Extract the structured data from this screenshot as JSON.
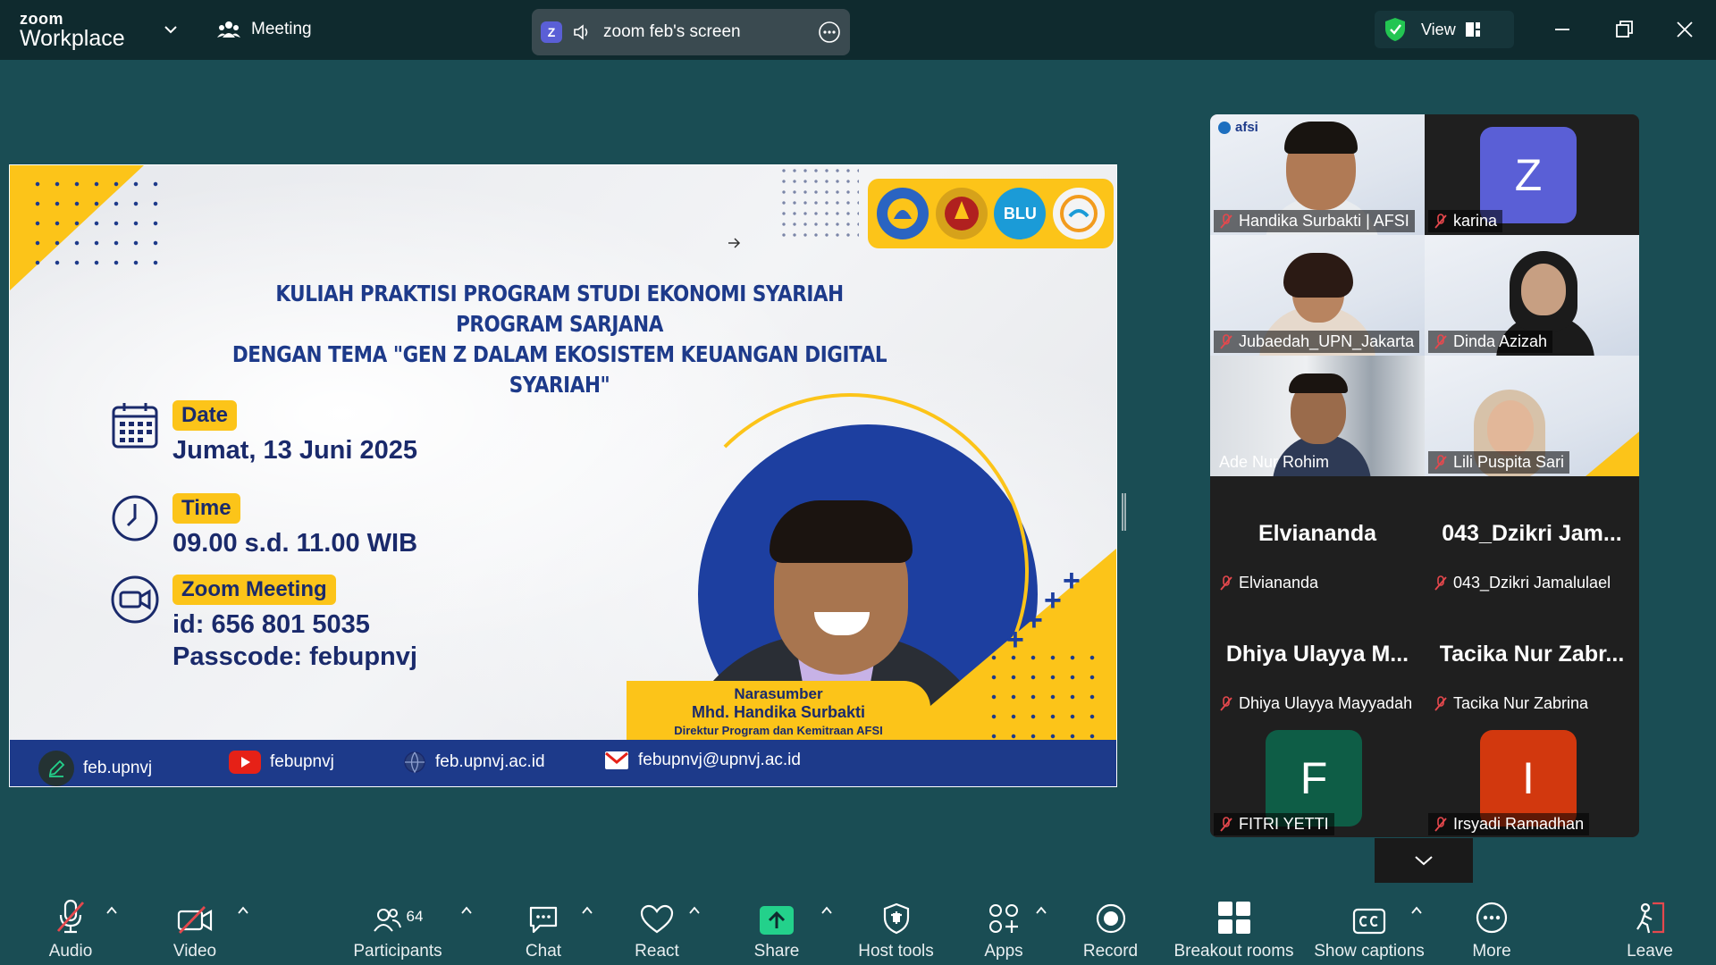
{
  "titlebar": {
    "logo_top": "zoom",
    "logo_bottom": "Workplace",
    "meeting_label": "Meeting",
    "zoom_badge": "Z",
    "share_label": "zoom feb's screen",
    "view_label": "View"
  },
  "slide": {
    "title_line1": "KULIAH PRAKTISI PROGRAM STUDI EKONOMI SYARIAH PROGRAM SARJANA",
    "title_line2": "DENGAN TEMA \"GEN Z DALAM EKOSISTEM KEUANGAN DIGITAL SYARIAH\"",
    "date_label": "Date",
    "date_value": "Jumat, 13 Juni 2025",
    "time_label": "Time",
    "time_value": "09.00 s.d. 11.00 WIB",
    "zoom_label": "Zoom Meeting",
    "zoom_id": "id: 656 801 5035",
    "zoom_pass": "Passcode: febupnvj",
    "speaker_role": "Narasumber",
    "speaker_name": "Mhd. Handika Surbakti",
    "speaker_title": "Direktur Program dan Kemitraan AFSI",
    "logo_blu": "BLU",
    "footer": {
      "instagram": "feb.upnvj",
      "youtube": "febupnvj",
      "web": "feb.upnvj.ac.id",
      "email": "febupnvj@upnvj.ac.id"
    }
  },
  "gallery": {
    "afsi_logo": "afsi",
    "tiles": [
      {
        "name": "Handika Surbakti | AFSI"
      },
      {
        "name": "karina",
        "initial": "Z",
        "color": "#5a5fd6"
      },
      {
        "name": "Jubaedah_UPN_Jakarta"
      },
      {
        "name": "Dinda Azizah"
      },
      {
        "name": "Ade Nur Rohim"
      },
      {
        "name": "Lili Puspita Sari"
      },
      {
        "name": "Elviananda",
        "display": "Elviananda"
      },
      {
        "name": "043_Dzikri Jamalulael",
        "display": "043_Dzikri  Jam..."
      },
      {
        "name": "Dhiya Ulayya Mayyadah",
        "display": "Dhiya Ulayya M..."
      },
      {
        "name": "Tacika Nur Zabrina",
        "display": "Tacika Nur Zabr..."
      },
      {
        "name": "FITRI YETTI",
        "initial": "F",
        "color": "#0e5d46"
      },
      {
        "name": "Irsyadi Ramadhan",
        "initial": "I",
        "color": "#d2380e"
      }
    ]
  },
  "toolbar": {
    "audio": "Audio",
    "video": "Video",
    "participants": "Participants",
    "participants_count": "64",
    "chat": "Chat",
    "react": "React",
    "share": "Share",
    "host_tools": "Host tools",
    "apps": "Apps",
    "record": "Record",
    "breakout": "Breakout rooms",
    "captions": "Show captions",
    "more": "More",
    "leave": "Leave"
  },
  "colors": {
    "background": "#1a4d54",
    "titlebar": "#0f2a2e",
    "share_green": "#23d18b",
    "mic_off_red": "#e5484d",
    "slide_yellow": "#fcc419",
    "slide_navy": "#1d3a8a"
  }
}
